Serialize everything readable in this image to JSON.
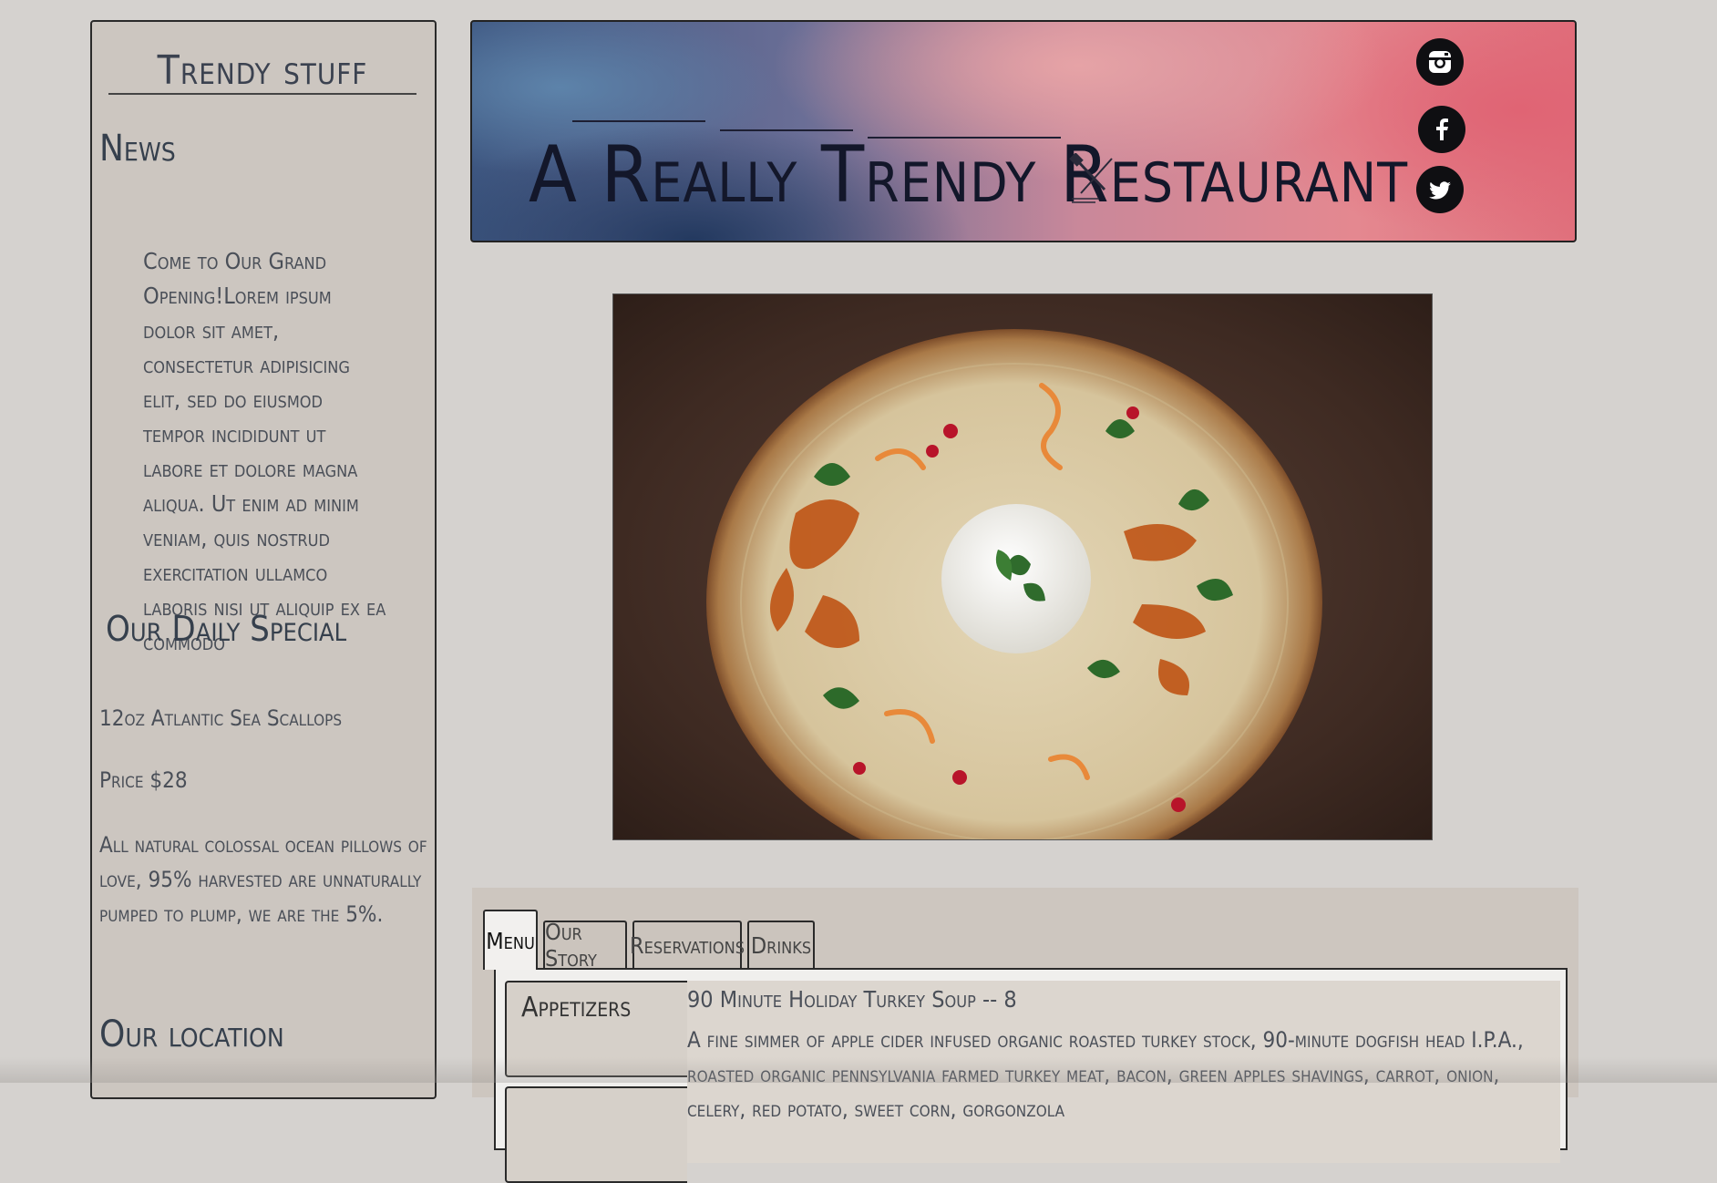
{
  "sidebar": {
    "brand": "Trendy stuff",
    "news_heading": "News",
    "news_body": "Come to Our Grand Opening!Lorem ipsum dolor sit amet, consectetur adipisicing elit, sed do eiusmod tempor incididunt ut labore et dolore magna aliqua. Ut enim ad minim veniam, quis nostrud exercitation ullamco laboris nisi ut aliquip ex ea commodo",
    "special_heading": "Our Daily Special",
    "special_item": "12oz Atlantic Sea Scallops",
    "special_price": "Price $28",
    "special_desc": "All natural colossal ocean pillows of love, 95% harvested are unnaturally pumped to plump, we are the 5%.",
    "location_heading": "Our location"
  },
  "header": {
    "title": "A Really Trendy Restaurant",
    "title_icon": "fork-knife-icon",
    "social": [
      {
        "name": "instagram",
        "icon": "instagram-icon"
      },
      {
        "name": "facebook",
        "icon": "facebook-icon"
      },
      {
        "name": "twitter",
        "icon": "twitter-icon"
      }
    ]
  },
  "hero": {
    "image": "food-plate-image"
  },
  "tabs": {
    "items": [
      "Menu",
      "Our Story",
      "Reservations",
      "Drinks"
    ],
    "active": "Menu"
  },
  "menu": {
    "categories": [
      "Appetizers"
    ],
    "items": [
      {
        "title": "90 Minute Holiday Turkey Soup -- 8",
        "desc": "A fine simmer of apple cider infused organic roasted turkey stock, 90-minute dogfish head I.P.A., roasted organic pennsylvania farmed turkey meat, bacon, green apples shavings, carrot, onion, celery, red potato, sweet corn, gorgonzola"
      }
    ]
  },
  "colors": {
    "page_bg": "#d5d2cf",
    "sidebar_bg": "#ccc6c0",
    "text": "#3a3f4a",
    "banner_blue": "#23395f",
    "banner_pink": "#e06474"
  }
}
